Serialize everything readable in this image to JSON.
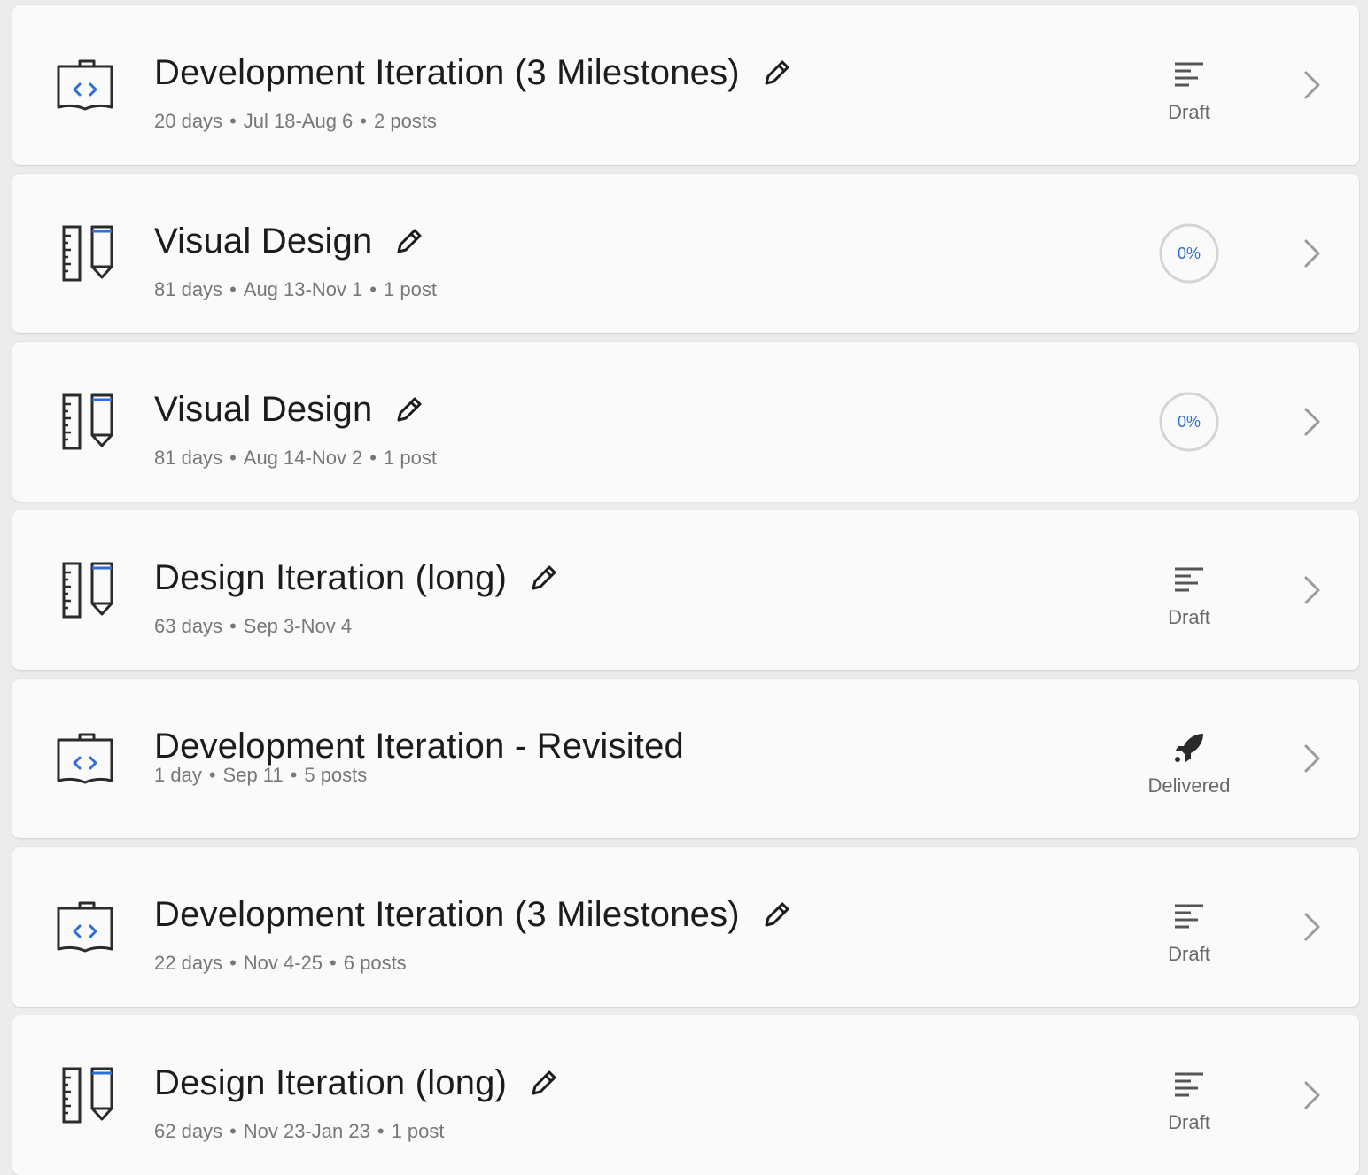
{
  "colors": {
    "card_background": "#fafafa",
    "page_background": "#ececec",
    "title_text": "#1c1c1c",
    "meta_text": "#777777",
    "accent_blue": "#2d6fd6",
    "icon_dark": "#2b2b2b"
  },
  "items": [
    {
      "icon": "development-iteration-icon",
      "title": "Development Iteration (3 Milestones)",
      "editable": true,
      "duration": "20 days",
      "dates": "Jul 18-Aug 6",
      "posts": "2 posts",
      "status_type": "draft",
      "status_icon": "draft-lines-icon",
      "status_label": "Draft"
    },
    {
      "icon": "design-iteration-icon",
      "title": "Visual Design",
      "editable": true,
      "duration": "81 days",
      "dates": "Aug 13-Nov 1",
      "posts": "1 post",
      "status_type": "progress",
      "progress_value": 0,
      "progress_text": "0%"
    },
    {
      "icon": "design-iteration-icon",
      "title": "Visual Design",
      "editable": true,
      "duration": "81 days",
      "dates": "Aug 14-Nov 2",
      "posts": "1 post",
      "status_type": "progress",
      "progress_value": 0,
      "progress_text": "0%"
    },
    {
      "icon": "design-iteration-icon",
      "title": "Design Iteration (long)",
      "editable": true,
      "duration": "63 days",
      "dates": "Sep 3-Nov 4",
      "posts": "",
      "status_type": "draft",
      "status_icon": "draft-lines-icon",
      "status_label": "Draft"
    },
    {
      "icon": "development-iteration-icon",
      "title": "Development Iteration - Revisited",
      "editable": false,
      "duration": "1 day",
      "dates": "Sep 11",
      "posts": "5 posts",
      "status_type": "delivered",
      "status_icon": "rocket-icon",
      "status_label": "Delivered"
    },
    {
      "icon": "development-iteration-icon",
      "title": "Development Iteration (3 Milestones)",
      "editable": true,
      "duration": "22 days",
      "dates": "Nov 4-25",
      "posts": "6 posts",
      "status_type": "draft",
      "status_icon": "draft-lines-icon",
      "status_label": "Draft"
    },
    {
      "icon": "design-iteration-icon",
      "title": "Design Iteration (long)",
      "editable": true,
      "duration": "62 days",
      "dates": "Nov 23-Jan 23",
      "posts": "1 post",
      "status_type": "draft",
      "status_icon": "draft-lines-icon",
      "status_label": "Draft"
    }
  ]
}
